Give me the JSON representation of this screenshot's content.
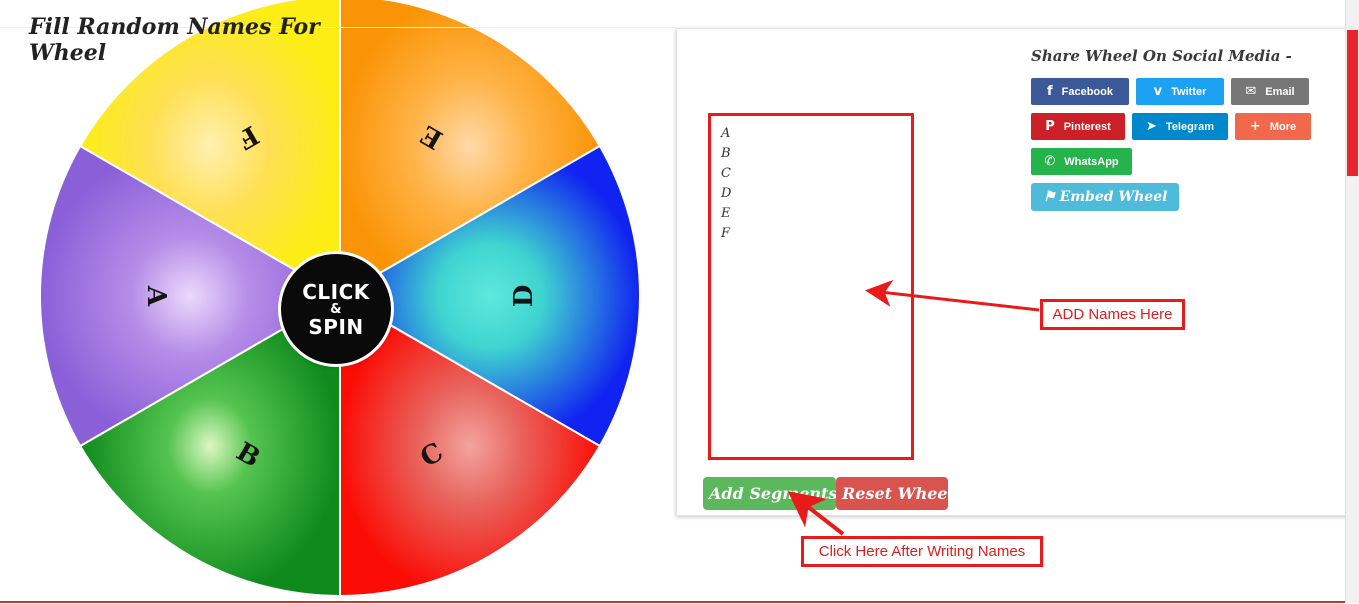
{
  "wheel": {
    "hub": {
      "line1": "CLICK",
      "line2": "&",
      "line3": "SPIN"
    },
    "segments": [
      {
        "label": "E",
        "color_inner": "#ffc98a",
        "color_outer": "#fa9406",
        "start_deg": -90,
        "end_deg": -30
      },
      {
        "label": "D",
        "color_inner": "#46dcd2",
        "color_outer": "#1123f0",
        "start_deg": -30,
        "end_deg": 30
      },
      {
        "label": "C",
        "color_inner": "#e8756d",
        "color_outer": "#fb0d06",
        "start_deg": 30,
        "end_deg": 90
      },
      {
        "label": "B",
        "color_inner": "#c7f0a8",
        "color_outer": "#128a20",
        "start_deg": 90,
        "end_deg": 150
      },
      {
        "label": "A",
        "color_inner": "#e0c8f5",
        "color_outer": "#9066dc",
        "start_deg": 150,
        "end_deg": 210
      },
      {
        "label": "F",
        "color_inner": "#ffe49a",
        "color_outer": "#fcee14",
        "start_deg": 210,
        "end_deg": 270
      }
    ]
  },
  "card": {
    "title": "Fill Random Names For Wheel",
    "textarea": {
      "value": "A\nB\nC\nD\nE\nF",
      "placeholder": ""
    },
    "share": {
      "title": "Share Wheel On Social Media -",
      "buttons": [
        {
          "label": "Facebook",
          "icon": "facebook-icon",
          "glyph": "f",
          "color": "#3b5998"
        },
        {
          "label": "Twitter",
          "icon": "twitter-icon",
          "glyph": "ᴠ",
          "color": "#1da1f2"
        },
        {
          "label": "Email",
          "icon": "envelope-icon",
          "glyph": "✉",
          "color": "#777777"
        },
        {
          "label": "Pinterest",
          "icon": "pinterest-icon",
          "glyph": "P",
          "color": "#cb2027"
        },
        {
          "label": "Telegram",
          "icon": "telegram-icon",
          "glyph": "➤",
          "color": "#0088cc"
        },
        {
          "label": "More",
          "icon": "plus-icon",
          "glyph": "+",
          "color": "#f2684c"
        },
        {
          "label": "WhatsApp",
          "icon": "whatsapp-icon",
          "glyph": "✆",
          "color": "#25b34b"
        }
      ],
      "embed": {
        "label": "Embed Wheel",
        "icon": "tag-icon",
        "glyph": "🏷",
        "color": "#4dbbd9"
      }
    },
    "actions": {
      "add_segments": "Add Segments",
      "reset_wheel": "Reset Wheel"
    }
  },
  "annotations": {
    "accent_color": "#e81a1a",
    "add_names": "ADD Names Here",
    "click_here": "Click Here After Writing Names"
  }
}
